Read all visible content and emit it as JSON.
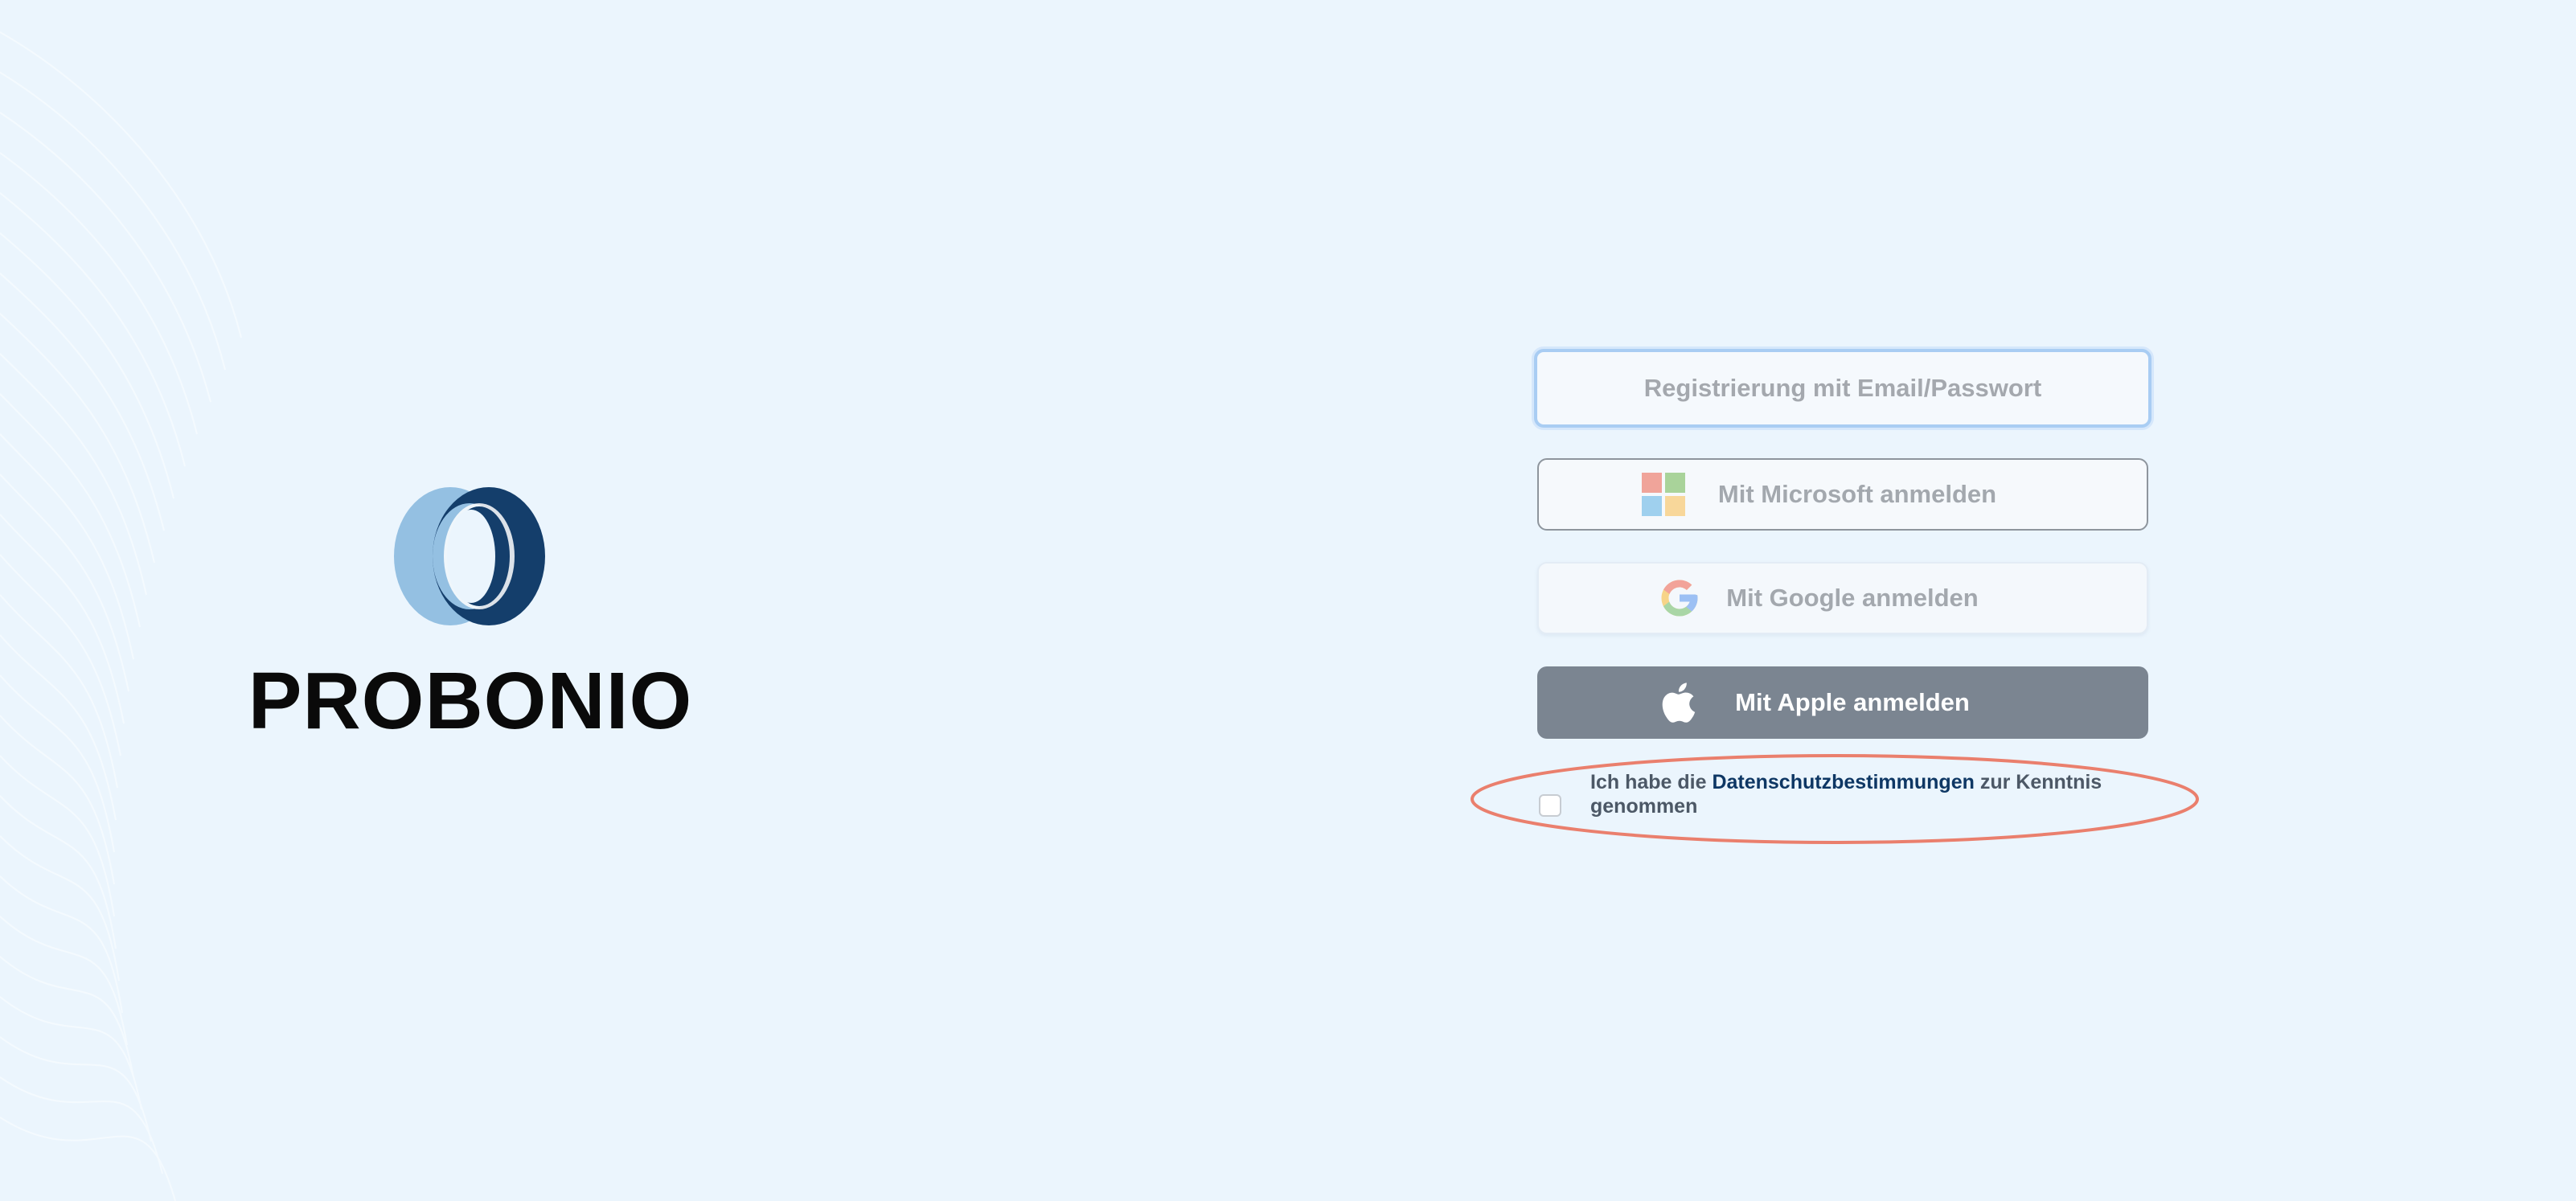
{
  "brand": {
    "name": "PROBONIO",
    "logo_icon": "probonio-logo-icon",
    "colors": {
      "logo_dark": "#143e6b",
      "logo_light": "#94c0e2"
    }
  },
  "auth": {
    "email_button_label": "Registrierung mit Email/Passwort",
    "microsoft_button_label": "Mit Microsoft anmelden",
    "microsoft_icon": "microsoft-icon",
    "google_button_label": "Mit Google anmelden",
    "google_icon": "google-icon",
    "apple_button_label": "Mit Apple anmelden",
    "apple_icon": "apple-icon"
  },
  "consent": {
    "checked": false,
    "text_before": "Ich habe die ",
    "link_text": "Datenschutzbestimmungen",
    "text_after": " zur Kenntnis genommen"
  },
  "annotation": {
    "color": "#ea7f6d"
  },
  "colors": {
    "background": "#ebf5fd",
    "apple_button": "#7b8591",
    "link": "#0e3764"
  }
}
